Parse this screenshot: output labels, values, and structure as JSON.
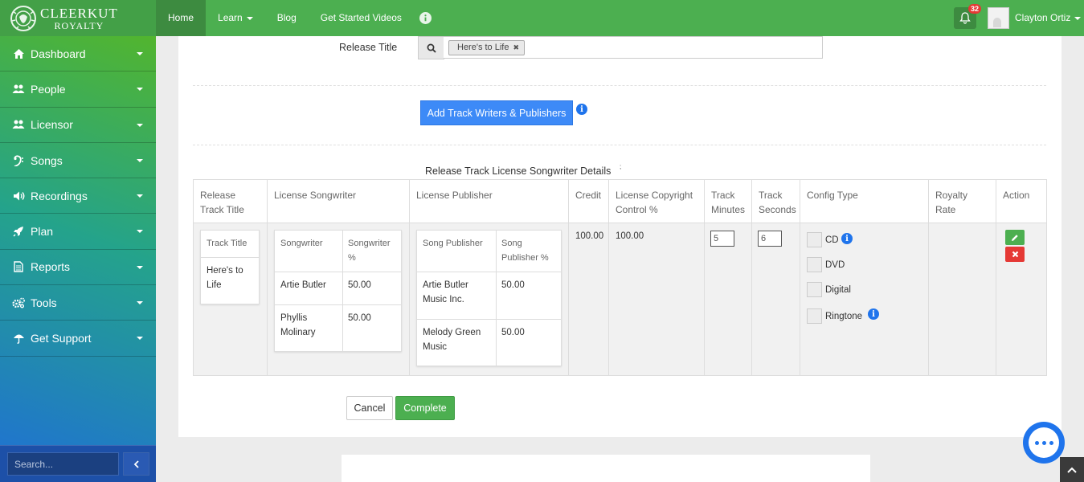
{
  "brand": {
    "line1": "CLEERKUT",
    "line2": "ROYALTY"
  },
  "topnav": {
    "items": [
      {
        "label": "Home"
      },
      {
        "label": "Learn"
      },
      {
        "label": "Blog"
      },
      {
        "label": "Get Started Videos"
      }
    ],
    "notification_count": "32",
    "user_name": "Clayton Ortiz"
  },
  "sidebar": {
    "items": [
      {
        "label": "Dashboard",
        "icon": "home-icon"
      },
      {
        "label": "People",
        "icon": "users-icon"
      },
      {
        "label": "Licensor",
        "icon": "users-icon"
      },
      {
        "label": "Songs",
        "icon": "bass-clef-icon"
      },
      {
        "label": "Recordings",
        "icon": "volume-icon"
      },
      {
        "label": "Plan",
        "icon": "rocket-icon"
      },
      {
        "label": "Reports",
        "icon": "file-icon"
      },
      {
        "label": "Tools",
        "icon": "cogs-icon"
      },
      {
        "label": "Get Support",
        "icon": "umbrella-icon"
      }
    ],
    "search_placeholder": "Search..."
  },
  "form": {
    "release_title_label": "Release Title",
    "release_tag": "Here's to Life",
    "add_button_label": "Add Track Writers & Publishers",
    "details_title": "Release Track License Songwriter Details",
    "details_sub": ";"
  },
  "table": {
    "headers": {
      "release_track_title": "Release Track Title",
      "license_songwriter": "License Songwriter",
      "license_publisher": "License Publisher",
      "credit": "Credit",
      "copyright_control": "License Copyright Control %",
      "track_minutes": "Track Minutes",
      "track_seconds": "Track Seconds",
      "config_type": "Config Type",
      "royalty_rate": "Royalty Rate",
      "action": "Action"
    },
    "row": {
      "track_title_header": "Track Title",
      "track_title": "Here's to Life",
      "songwriter_headers": {
        "name": "Songwriter",
        "pct": "Songwriter %"
      },
      "songwriters": [
        {
          "name": "Artie Butler",
          "pct": "50.00"
        },
        {
          "name": "Phyllis Molinary",
          "pct": "50.00"
        }
      ],
      "publisher_headers": {
        "name": "Song Publisher",
        "pct": "Song Publisher %"
      },
      "publishers": [
        {
          "name": "Artie Butler Music Inc.",
          "pct": "50.00"
        },
        {
          "name": "Melody Green Music",
          "pct": "50.00"
        }
      ],
      "credit": "100.00",
      "copyright_control": "100.00",
      "track_minutes": "5",
      "track_seconds": "6",
      "config_options": [
        {
          "label": "CD",
          "checked": false
        },
        {
          "label": "DVD",
          "checked": false
        },
        {
          "label": "Digital",
          "checked": false
        },
        {
          "label": "Ringtone",
          "checked": false
        }
      ],
      "royalty_rate": ""
    }
  },
  "buttons": {
    "cancel": "Cancel",
    "complete": "Complete"
  },
  "colors": {
    "topbar": "#4caf50",
    "primary": "#3d8af7",
    "success": "#4caf50",
    "danger": "#e53935",
    "info": "#1f74ec"
  }
}
